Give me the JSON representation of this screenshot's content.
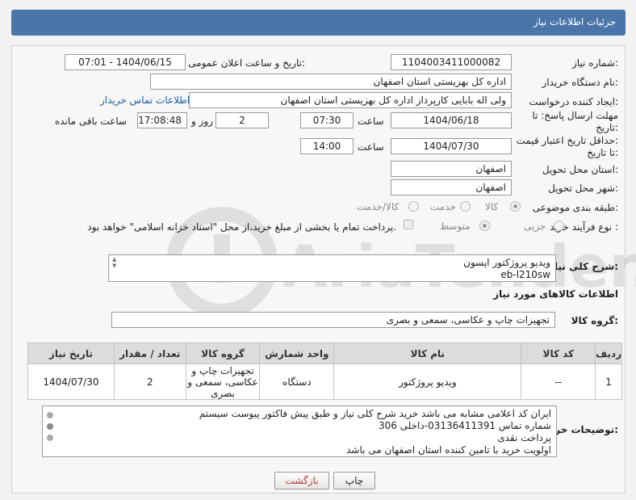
{
  "header": {
    "title": "جزئیات اطلاعات نیاز"
  },
  "fields": {
    "need_number_label": "شماره نیاز:",
    "need_number": "1104003411000082",
    "announce_label": "تاریخ و ساعت اعلان عمومی:",
    "announce_value": "1404/06/15 - 07:01",
    "buyer_org_label": "نام دستگاه خریدار:",
    "buyer_org": "اداره کل بهزیستی استان اصفهان",
    "requester_label": "ایجاد کننده درخواست:",
    "requester": "ولی اله بابایی کارپرداز اداره کل بهزیستی استان اصفهان",
    "buyer_contact_link": "اطلاعات تماس خریدار",
    "reply_deadline_label_1": "مهلت ارسال پاسخ: تا",
    "reply_deadline_label_2": "تاریخ:",
    "reply_date": "1404/06/18",
    "time_label": "ساعت",
    "reply_time": "07:30",
    "days_value": "2",
    "days_label": "روز و",
    "remaining_time": "17:08:48",
    "remaining_label": "ساعت باقی مانده",
    "price_validity_label_1": "حداقل تاریخ اعتبار قیمت:",
    "price_validity_label_2": "تا تاریخ:",
    "price_date": "1404/07/30",
    "price_time": "14:00",
    "province_label": "استان محل تحویل:",
    "province": "اصفهان",
    "city_label": "شهر محل تحویل:",
    "city": "اصفهان",
    "category_label": "طبقه بندی موضوعی:",
    "category_options": [
      "کالا",
      "خدمت",
      "کالا/خدمت"
    ],
    "process_label": "نوع فرآیند خرید :",
    "process_options": [
      "جزیی",
      "متوسط"
    ],
    "payment_note": "پرداخت تمام یا بخشی از مبلغ خرید،از محل \"اسناد خزانه اسلامی\" خواهد بود.",
    "description_label": "شرح کلی نیاز:",
    "description": "ویدیو پروژکتور  اپسون\neb-l210sw",
    "goods_info_title": "اطلاعات کالاهای مورد نیاز",
    "goods_group_label": "گروه کالا:",
    "goods_group": "تجهیزات چاپ و عکاسی، سمعی و بصری",
    "buyer_notes_label": "توضیحات خریدار:",
    "buyer_notes": "ایران کد اعلامی مشابه می باشد خرید شرح کلی نیاز و طبق پیش فاکتور پیوست سیستم\nشماره تماس 03136411391-داخلی 306\nپرداخت نقدی\nاولویت خرید با تامین کننده استان اصفهان  می باشد"
  },
  "table": {
    "headers": [
      "ردیف",
      "کد کالا",
      "نام کالا",
      "واحد شمارش",
      "گروه کالا",
      "تعداد / مقدار",
      "تاریخ نیاز"
    ],
    "row": [
      "1",
      "--",
      "ویدیو پروژکتور",
      "دستگاه",
      "تجهیزات چاپ و عکاسی، سمعی و بصری",
      "2",
      "1404/07/30"
    ]
  },
  "buttons": {
    "print": "چاپ",
    "back": "بازگشت"
  },
  "watermark_text": "AriaTender.neT",
  "colors": {
    "header": "#4a75a8",
    "link": "#1a5ea8",
    "back_text": "#c0392b"
  }
}
